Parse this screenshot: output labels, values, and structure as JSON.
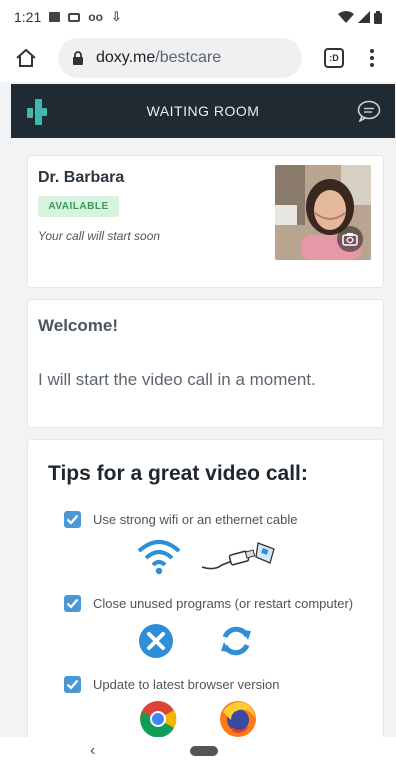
{
  "status_bar": {
    "time": "1:21",
    "voicemail": "oo",
    "download": "⇩"
  },
  "browser": {
    "url_host": "doxy.me",
    "url_path": "/bestcare",
    "tab_label": ":D"
  },
  "header": {
    "title": "WAITING ROOM"
  },
  "provider": {
    "name": "Dr. Barbara",
    "badge": "AVAILABLE",
    "status": "Your call will start soon"
  },
  "welcome": {
    "title": "Welcome!",
    "message": "I will start the video call in a moment."
  },
  "tips": {
    "title": "Tips for a great video call:",
    "items": [
      {
        "label": "Use strong wifi or an ethernet cable",
        "icons": [
          "wifi-icon",
          "ethernet-cable-icon"
        ]
      },
      {
        "label": "Close unused programs (or restart computer)",
        "icons": [
          "close-circle-icon",
          "refresh-icon"
        ]
      },
      {
        "label": "Update to latest browser version",
        "icons": [
          "chrome-icon",
          "firefox-icon"
        ]
      }
    ]
  },
  "nav": {
    "back": "‹"
  },
  "colors": {
    "header_bg": "#1f2a33",
    "accent_teal": "#3fb8b0",
    "badge_bg": "#d8f3df",
    "badge_text": "#3a9a55",
    "checkbox": "#4b97d6",
    "icon_blue": "#2e8fd8"
  }
}
